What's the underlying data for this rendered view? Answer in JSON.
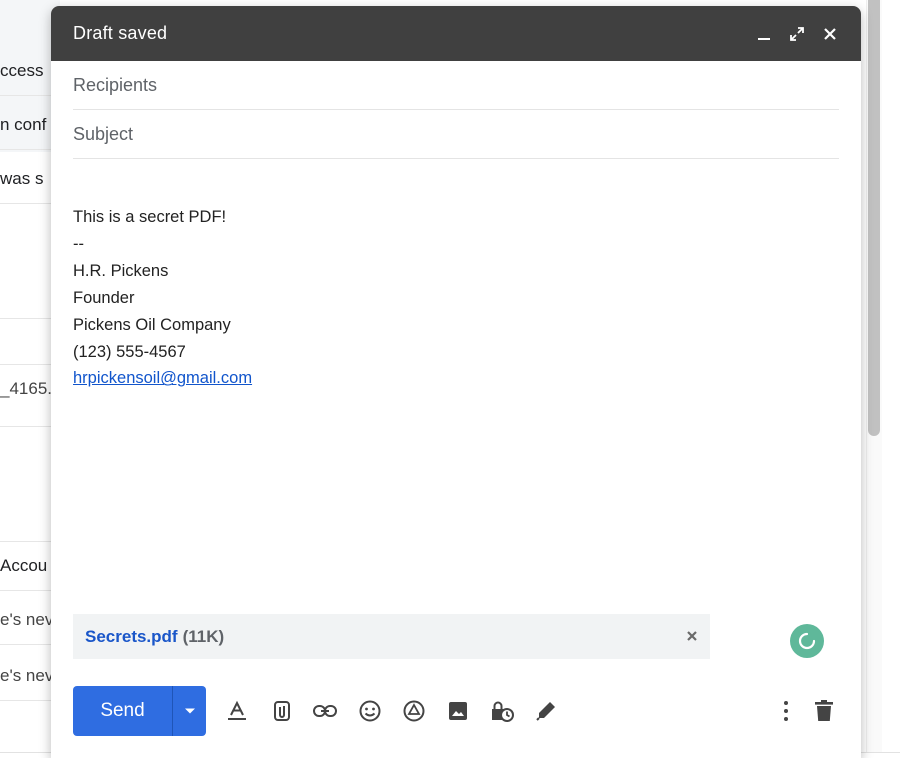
{
  "background": {
    "rows": [
      "ccess",
      "n conf",
      " was s",
      "",
      "",
      "_4165.",
      "",
      "Accou",
      "e's nev",
      "e's nev"
    ]
  },
  "compose": {
    "title": "Draft saved",
    "recipients_placeholder": "Recipients",
    "subject_placeholder": "Subject",
    "body_lines": [
      "This is a secret PDF!",
      "--",
      "H.R. Pickens",
      "Founder",
      "Pickens Oil Company",
      "(123) 555-4567"
    ],
    "email_link": "hrpickensoil@gmail.com",
    "attachment": {
      "name": "Secrets.pdf",
      "size": "(11K)"
    },
    "send_label": "Send",
    "colors": {
      "header": "#404040",
      "send": "#2f6de1",
      "link": "#1155cc",
      "attachment_name": "#1a56c9",
      "loader": "#5fb89a"
    },
    "toolbar_icons": [
      "formatting-icon",
      "attach-file-icon",
      "insert-link-icon",
      "emoji-icon",
      "drive-icon",
      "insert-photo-icon",
      "confidential-mode-icon",
      "signature-icon",
      "more-options-icon",
      "discard-draft-icon"
    ]
  }
}
